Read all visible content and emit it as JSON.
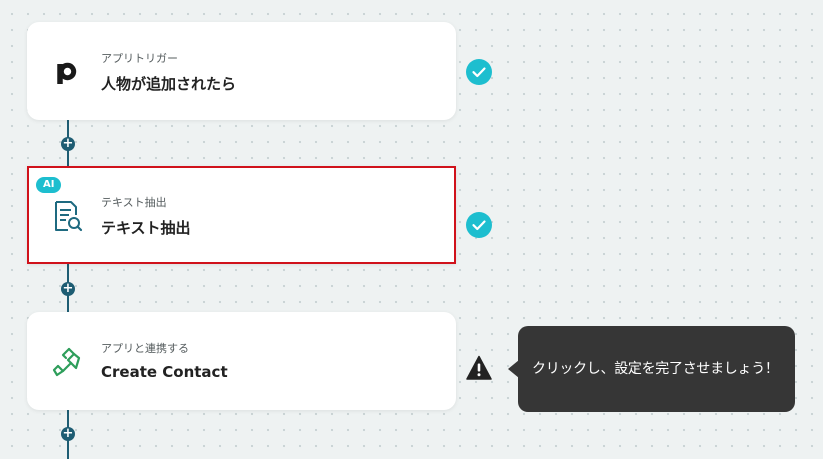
{
  "flow": {
    "steps": [
      {
        "sublabel": "アプリトリガー",
        "title": "人物が追加されたら",
        "icon": "pipedrive-p-icon",
        "status": "completed"
      },
      {
        "badge": "AI",
        "sublabel": "テキスト抽出",
        "title": "テキスト抽出",
        "icon": "document-search-icon",
        "status": "completed",
        "selected": true
      },
      {
        "sublabel": "アプリと連携する",
        "title": "Create Contact",
        "icon": "handshake-icon",
        "status": "warning"
      }
    ],
    "add_button_symbol": "+"
  },
  "tooltip": {
    "text": "クリックし、設定を完了させましょう！"
  },
  "colors": {
    "connector": "#1e5d73",
    "check": "#1dbecf",
    "selected_border": "#d0121b",
    "tooltip_bg": "#363636",
    "handshake": "#2e9e5b"
  }
}
